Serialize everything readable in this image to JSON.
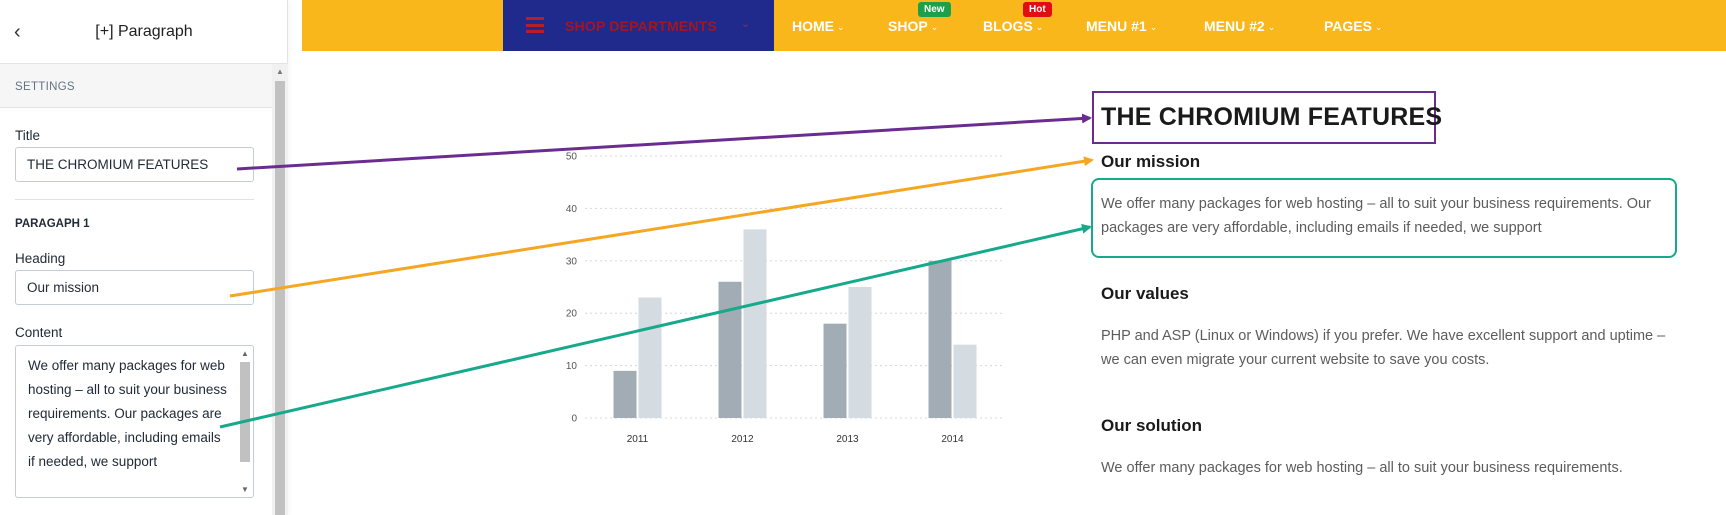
{
  "panel": {
    "header_title": "[+] Paragraph",
    "settings_label": "SETTINGS",
    "title_label": "Title",
    "title_value": "THE CHROMIUM FEATURES",
    "paragraph_label": "PARAGAPH 1",
    "heading_label": "Heading",
    "heading_value": "Our mission",
    "content_label": "Content",
    "content_value": "We offer many packages for web hosting – all to suit your business requirements. Our packages are very affordable, including emails if needed, we support"
  },
  "nav": {
    "departments_label": "SHOP DEPARTMENTS",
    "items": [
      {
        "label": "HOME"
      },
      {
        "label": "SHOP",
        "badge": "New"
      },
      {
        "label": "BLOGS",
        "badge": "Hot"
      },
      {
        "label": "MENU #1"
      },
      {
        "label": "MENU #2"
      },
      {
        "label": "PAGES"
      }
    ]
  },
  "content": {
    "title": "THE CHROMIUM FEATURES",
    "sections": [
      {
        "heading": "Our mission",
        "text": "We offer many packages for web hosting – all to suit your business requirements. Our packages are very affordable, including emails if needed, we support"
      },
      {
        "heading": "Our values",
        "text": "PHP and ASP (Linux or Windows) if you prefer. We have excellent support and uptime – we can even migrate your current website to save you costs."
      },
      {
        "heading": "Our solution",
        "text": "We offer many packages for web hosting – all to suit your business requirements."
      }
    ]
  },
  "chart_data": {
    "type": "bar",
    "categories": [
      "2011",
      "2012",
      "2013",
      "2014"
    ],
    "series": [
      {
        "values": [
          9,
          26,
          18,
          30
        ],
        "color": "#a2acb4"
      },
      {
        "values": [
          23,
          36,
          25,
          14
        ],
        "color": "#d4dbe1"
      }
    ],
    "ylim": [
      0,
      50
    ],
    "yticks": [
      0,
      10,
      20,
      30,
      40,
      50
    ],
    "grid": true,
    "title": "",
    "xlabel": "",
    "ylabel": ""
  },
  "colors": {
    "nav_bg": "#f9b71c",
    "departments_bg": "#1f2a8c",
    "title_arrow": "#6b2c91",
    "heading_arrow": "#f5a623",
    "content_arrow": "#17a98b"
  }
}
